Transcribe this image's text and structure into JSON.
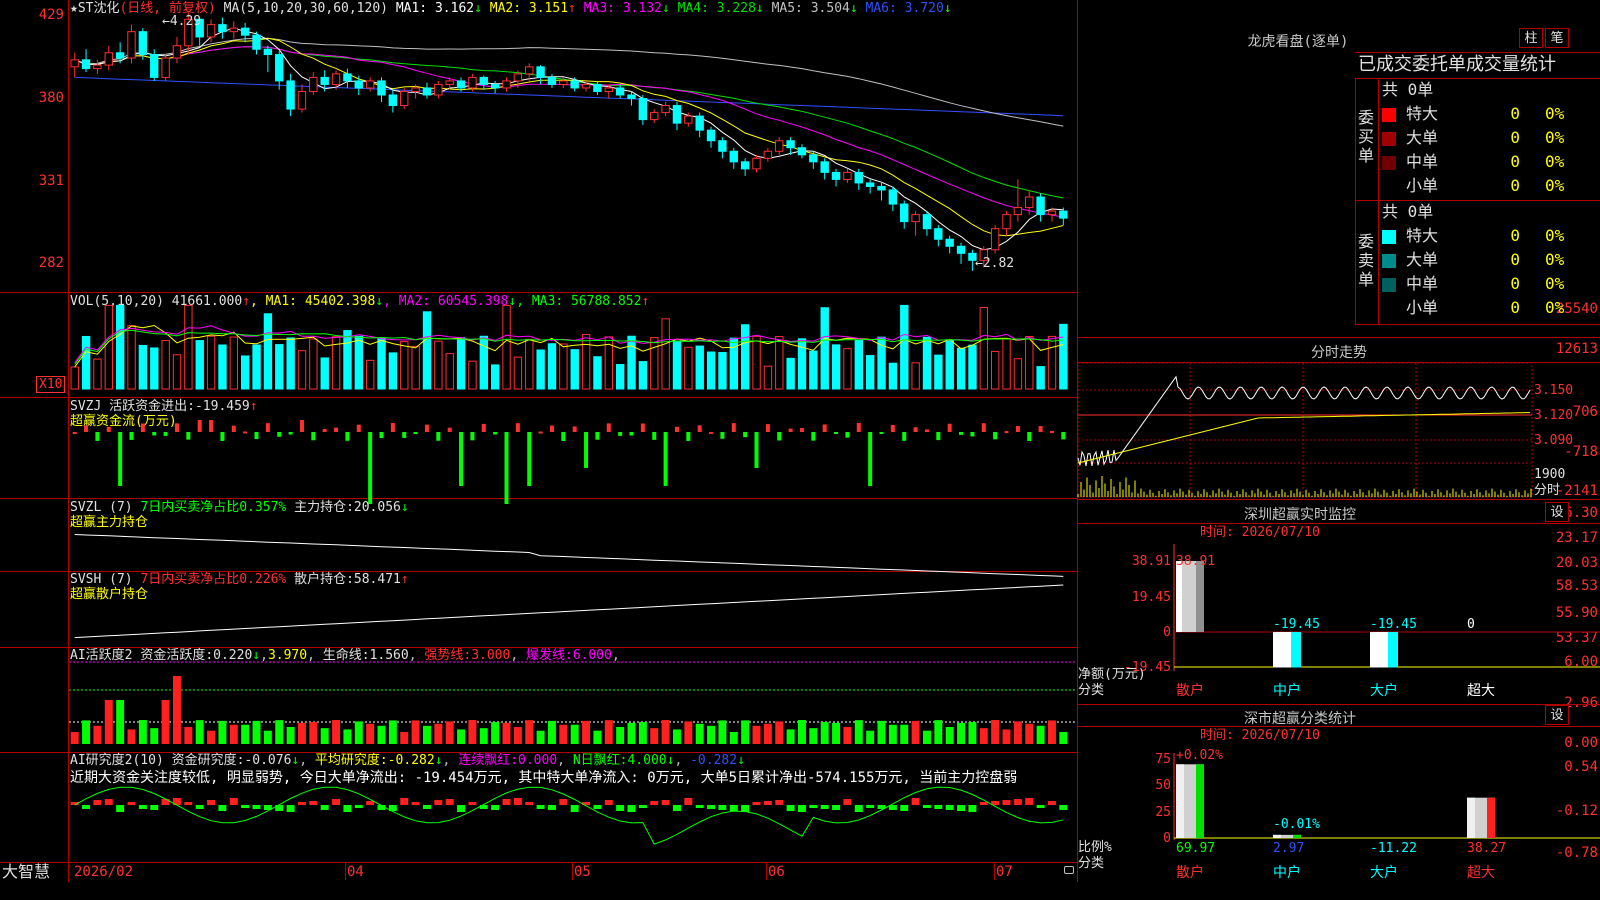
{
  "main_chart": {
    "title": "★ST沈化",
    "period_label": "(日线, 前复权)",
    "ma_label": "MA(5,10,20,30,60,120)",
    "ma_values": [
      {
        "name": "MA1",
        "value": "3.162",
        "arrow": "↓",
        "color": "#ffffff"
      },
      {
        "name": "MA2",
        "value": "3.151",
        "arrow": "↑",
        "color": "#ffff00"
      },
      {
        "name": "MA3",
        "value": "3.132",
        "arrow": "↓",
        "color": "#ff00ff"
      },
      {
        "name": "MA4",
        "value": "3.228",
        "arrow": "↓",
        "color": "#00e000"
      },
      {
        "name": "MA5",
        "value": "3.504",
        "arrow": "↓",
        "color": "#c0c0c0"
      },
      {
        "name": "MA6",
        "value": "3.720",
        "arrow": "↓",
        "color": "#3050ff"
      }
    ],
    "y_ticks": [
      "429",
      "380",
      "331",
      "282"
    ],
    "high_marker": "4.29",
    "low_marker": "2.82"
  },
  "volume": {
    "label": "VOL(5,10,20)",
    "value": "41661.000",
    "arrow": "↑",
    "ma": [
      {
        "name": "MA1",
        "value": "45402.398",
        "arrow": "↓",
        "color": "#ffff00"
      },
      {
        "name": "MA2",
        "value": "60545.398",
        "arrow": "↓",
        "color": "#ff00ff"
      },
      {
        "name": "MA3",
        "value": "56788.852",
        "arrow": "↑",
        "color": "#00ff00"
      }
    ],
    "y_ticks": [
      "25540",
      "12613"
    ],
    "unit": "X10"
  },
  "svzj": {
    "label": "SVZJ",
    "text": "活跃资金进出:",
    "value": "-19.459",
    "arrow": "↑",
    "sub": "超赢资金流(万元)",
    "y_ticks": [
      "706",
      "-718",
      "-2141"
    ]
  },
  "svzl": {
    "label": "SVZL (7)",
    "text": "7日内买卖净占比0.357%",
    "text2": "主力持仓:",
    "value": "20.056",
    "arrow": "↓",
    "sub": "超赢主力持仓",
    "y_ticks": [
      "26.30",
      "23.17",
      "20.03"
    ]
  },
  "svsh": {
    "label": "SVSH (7)",
    "text": "7日内买卖净占比0.226%",
    "text2": "散户持仓:",
    "value": "58.471",
    "arrow": "↑",
    "sub": "超赢散户持仓",
    "y_ticks": [
      "58.53",
      "55.90",
      "53.37"
    ]
  },
  "ai_activity": {
    "label": "AI活跃度2",
    "t1": "资金活跃度:",
    "v1": "0.220",
    "a1": "↓",
    "v2": "3.970",
    "t3": "生命线:",
    "v3": "1.560",
    "t4": "强势线:",
    "v4": "3.000",
    "t5": "爆发线:",
    "v5": "6.000",
    "y_ticks": [
      "6.00",
      "2.96",
      "0.00"
    ]
  },
  "ai_research": {
    "label": "AI研究度2(10)",
    "t1": "资金研究度:",
    "v1": "-0.076",
    "a1": "↓",
    "t2": "平均研究度:",
    "v2": "-0.282",
    "a2": "↓",
    "t3": "连续飘红:",
    "v3": "0.000",
    "t4": "N日飘红:",
    "v4": "4.000",
    "a4": "↓",
    "v5": "-0.282",
    "a5": "↓",
    "comment": "近期大资金关注度较低, 明显弱势, 今日大单净流出: -19.454万元, 其中特大单净流入: 0万元, 大单5日累计净出-574.155万元, 当前主力控盘弱",
    "y_ticks": [
      "0.54",
      "-0.12",
      "-0.78"
    ]
  },
  "x_axis": {
    "labels": [
      "2026/02",
      "04",
      "05",
      "06",
      "07"
    ],
    "brand": "大智慧"
  },
  "dragon_tiger": {
    "title": "龙虎看盘(逐单)",
    "btn1": "柱",
    "btn2": "笔",
    "header": "已成交委托单成交量统计",
    "buy": {
      "side_label": "委买单",
      "total": "共 0单",
      "rows": [
        {
          "name": "特大",
          "count": "0",
          "pct": "0%",
          "color": "#ff0000"
        },
        {
          "name": "大单",
          "count": "0",
          "pct": "0%",
          "color": "#a00000"
        },
        {
          "name": "中单",
          "count": "0",
          "pct": "0%",
          "color": "#700000"
        },
        {
          "name": "小单",
          "count": "0",
          "pct": "0%",
          "color": ""
        }
      ]
    },
    "sell": {
      "side_label": "委卖单",
      "total": "共 0单",
      "rows": [
        {
          "name": "特大",
          "count": "0",
          "pct": "0%",
          "color": "#00ffff"
        },
        {
          "name": "大单",
          "count": "0",
          "pct": "0%",
          "color": "#008c8c"
        },
        {
          "name": "中单",
          "count": "0",
          "pct": "0%",
          "color": "#006060"
        },
        {
          "name": "小单",
          "count": "0",
          "pct": "0%",
          "color": ""
        }
      ]
    }
  },
  "intraday": {
    "title": "分时走势",
    "price_ticks": [
      "3.150",
      "3.120",
      "3.090"
    ],
    "vol_tick": "1900",
    "unit": "分时"
  },
  "sz_monitor": {
    "title": "深圳超赢实时监控",
    "btn": "设",
    "time_label": "时间: 2026/07/10",
    "y_ticks": [
      "38.91",
      "19.45",
      "0",
      "-19.45"
    ],
    "y_label": "净额(万元)",
    "x_label": "分类",
    "bars": [
      {
        "label": "散户",
        "value": 38.91,
        "value_text": "38.91"
      },
      {
        "label": "中户",
        "value": -19.45,
        "value_text": "-19.45"
      },
      {
        "label": "大户",
        "value": -19.45,
        "value_text": "-19.45"
      },
      {
        "label": "超大",
        "value": 0,
        "value_text": "0"
      }
    ]
  },
  "sz_category": {
    "title": "深市超赢分类统计",
    "btn": "设",
    "time_label": "时间: 2026/07/10",
    "y_ticks": [
      "75",
      "50",
      "25",
      "0"
    ],
    "y_label": "比例%",
    "x_label": "分类",
    "bars": [
      {
        "label": "散户",
        "value": 69.97,
        "change": "+0.02%",
        "value_text": "69.97"
      },
      {
        "label": "中户",
        "value": 2.97,
        "change": "-0.01%",
        "value_text": "2.97"
      },
      {
        "label": "大户",
        "value": -11.22,
        "change": "",
        "value_text": "-11.22"
      },
      {
        "label": "超大",
        "value": 38.27,
        "change": "",
        "value_text": "38.27"
      }
    ]
  },
  "chart_data": {
    "type": "candlestick",
    "title": "★ST沈化",
    "x_labels": [
      "2026/02",
      "04",
      "05",
      "06",
      "07"
    ],
    "ylim": [
      2.82,
      4.29
    ],
    "candles": [
      [
        3.98,
        4.02,
        3.92,
        4.06
      ],
      [
        4.02,
        3.97,
        3.95,
        4.08
      ],
      [
        3.97,
        3.99,
        3.94,
        4.02
      ],
      [
        3.99,
        4.06,
        3.96,
        4.1
      ],
      [
        4.06,
        4.03,
        4.0,
        4.12
      ],
      [
        4.03,
        4.18,
        4.0,
        4.22
      ],
      [
        4.18,
        4.05,
        4.02,
        4.2
      ],
      [
        4.05,
        3.92,
        3.9,
        4.08
      ],
      [
        3.92,
        4.03,
        3.9,
        4.05
      ],
      [
        4.03,
        4.1,
        4.0,
        4.15
      ],
      [
        4.1,
        4.25,
        4.05,
        4.29
      ],
      [
        4.25,
        4.15,
        4.1,
        4.26
      ],
      [
        4.15,
        4.22,
        4.12,
        4.25
      ],
      [
        4.22,
        4.18,
        4.14,
        4.26
      ],
      [
        4.18,
        4.2,
        4.14,
        4.24
      ],
      [
        4.2,
        4.16,
        4.12,
        4.23
      ],
      [
        4.16,
        4.08,
        4.05,
        4.18
      ],
      [
        4.08,
        4.05,
        3.95,
        4.1
      ],
      [
        4.05,
        3.9,
        3.85,
        4.07
      ],
      [
        3.9,
        3.74,
        3.7,
        3.94
      ],
      [
        3.74,
        3.84,
        3.72,
        3.88
      ],
      [
        3.84,
        3.92,
        3.82,
        3.95
      ],
      [
        3.92,
        3.88,
        3.84,
        3.96
      ],
      [
        3.88,
        3.94,
        3.85,
        3.96
      ],
      [
        3.94,
        3.9,
        3.86,
        3.97
      ],
      [
        3.9,
        3.86,
        3.82,
        3.93
      ],
      [
        3.86,
        3.9,
        3.84,
        3.92
      ],
      [
        3.9,
        3.82,
        3.78,
        3.92
      ],
      [
        3.82,
        3.76,
        3.72,
        3.85
      ],
      [
        3.76,
        3.84,
        3.74,
        3.86
      ],
      [
        3.84,
        3.86,
        3.8,
        3.88
      ],
      [
        3.86,
        3.82,
        3.8,
        3.89
      ],
      [
        3.82,
        3.88,
        3.8,
        3.9
      ],
      [
        3.88,
        3.9,
        3.85,
        3.92
      ],
      [
        3.9,
        3.86,
        3.84,
        3.92
      ],
      [
        3.86,
        3.92,
        3.84,
        3.94
      ],
      [
        3.92,
        3.88,
        3.85,
        3.93
      ],
      [
        3.88,
        3.86,
        3.83,
        3.9
      ],
      [
        3.86,
        3.9,
        3.84,
        3.92
      ],
      [
        3.9,
        3.94,
        3.86,
        3.96
      ],
      [
        3.94,
        3.98,
        3.9,
        4.0
      ],
      [
        3.98,
        3.92,
        3.88,
        3.99
      ],
      [
        3.92,
        3.88,
        3.86,
        3.94
      ],
      [
        3.88,
        3.9,
        3.86,
        3.92
      ],
      [
        3.9,
        3.86,
        3.84,
        3.92
      ],
      [
        3.86,
        3.88,
        3.84,
        3.9
      ],
      [
        3.88,
        3.84,
        3.82,
        3.9
      ],
      [
        3.84,
        3.86,
        3.8,
        3.88
      ],
      [
        3.86,
        3.82,
        3.8,
        3.88
      ],
      [
        3.82,
        3.8,
        3.76,
        3.84
      ],
      [
        3.8,
        3.68,
        3.65,
        3.82
      ],
      [
        3.68,
        3.72,
        3.66,
        3.74
      ],
      [
        3.72,
        3.76,
        3.7,
        3.78
      ],
      [
        3.76,
        3.66,
        3.62,
        3.78
      ],
      [
        3.66,
        3.7,
        3.64,
        3.72
      ],
      [
        3.7,
        3.62,
        3.58,
        3.72
      ],
      [
        3.62,
        3.56,
        3.52,
        3.64
      ],
      [
        3.56,
        3.5,
        3.46,
        3.58
      ],
      [
        3.5,
        3.44,
        3.4,
        3.52
      ],
      [
        3.44,
        3.4,
        3.36,
        3.46
      ],
      [
        3.4,
        3.46,
        3.38,
        3.48
      ],
      [
        3.46,
        3.5,
        3.44,
        3.52
      ],
      [
        3.5,
        3.56,
        3.48,
        3.58
      ],
      [
        3.56,
        3.52,
        3.48,
        3.58
      ],
      [
        3.52,
        3.48,
        3.46,
        3.54
      ],
      [
        3.48,
        3.44,
        3.4,
        3.5
      ],
      [
        3.44,
        3.38,
        3.34,
        3.46
      ],
      [
        3.38,
        3.34,
        3.3,
        3.4
      ],
      [
        3.34,
        3.38,
        3.32,
        3.4
      ],
      [
        3.38,
        3.32,
        3.28,
        3.4
      ],
      [
        3.32,
        3.3,
        3.26,
        3.34
      ],
      [
        3.3,
        3.28,
        3.22,
        3.32
      ],
      [
        3.28,
        3.2,
        3.16,
        3.3
      ],
      [
        3.2,
        3.1,
        3.06,
        3.22
      ],
      [
        3.1,
        3.14,
        3.02,
        3.16
      ],
      [
        3.14,
        3.06,
        3.02,
        3.16
      ],
      [
        3.06,
        3.0,
        2.96,
        3.08
      ],
      [
        3.0,
        2.96,
        2.92,
        3.02
      ],
      [
        2.96,
        2.92,
        2.86,
        2.98
      ],
      [
        2.92,
        2.88,
        2.82,
        2.94
      ],
      [
        2.88,
        2.94,
        2.84,
        2.96
      ],
      [
        2.94,
        3.06,
        2.92,
        3.08
      ],
      [
        3.06,
        3.14,
        3.02,
        3.16
      ],
      [
        3.14,
        3.18,
        3.1,
        3.34
      ],
      [
        3.18,
        3.24,
        3.14,
        3.28
      ],
      [
        3.24,
        3.14,
        3.1,
        3.26
      ],
      [
        3.14,
        3.16,
        3.1,
        3.18
      ],
      [
        3.16,
        3.12,
        3.08,
        3.18
      ]
    ]
  }
}
